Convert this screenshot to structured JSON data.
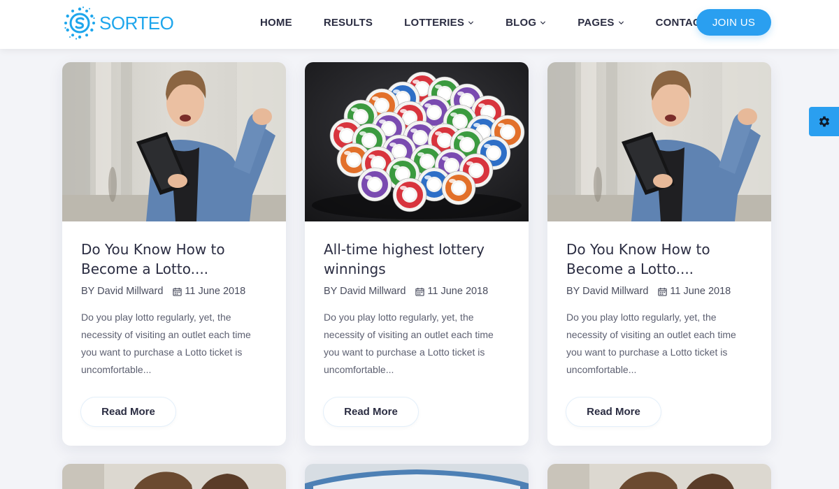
{
  "brand": {
    "name": "SORTEO",
    "accent": "#2a9ff0"
  },
  "nav": {
    "items": [
      {
        "label": "HOME",
        "dropdown": false
      },
      {
        "label": "RESULTS",
        "dropdown": false
      },
      {
        "label": "LOTTERIES",
        "dropdown": true
      },
      {
        "label": "BLOG",
        "dropdown": true
      },
      {
        "label": "PAGES",
        "dropdown": true
      },
      {
        "label": "CONTACT US",
        "dropdown": false
      }
    ],
    "cta_label": "JOIN US"
  },
  "settings_icon": "gear-icon",
  "posts": [
    {
      "image": "man-celebrating-with-tablet",
      "title_line1": "Do You Know How to",
      "title_line2": "Become a Lotto....",
      "author": "BY David Millward",
      "date": "11 June 2018",
      "excerpt": "Do you play lotto regularly, yet, the necessity of visiting an outlet each time you want to purchase a Lotto ticket is uncomfortable...",
      "button": "Read More"
    },
    {
      "image": "lottery-balls",
      "title_line1": "All-time highest lottery",
      "title_line2": "winnings",
      "author": "BY David Millward",
      "date": "11 June 2018",
      "excerpt": "Do you play lotto regularly, yet, the necessity of visiting an outlet each time you want to purchase a Lotto ticket is uncomfortable...",
      "button": "Read More"
    },
    {
      "image": "man-celebrating-with-tablet",
      "title_line1": "Do You Know How to",
      "title_line2": "Become a Lotto....",
      "author": "BY David Millward",
      "date": "11 June 2018",
      "excerpt": "Do you play lotto regularly, yet, the necessity of visiting an outlet each time you want to purchase a Lotto ticket is uncomfortable...",
      "button": "Read More"
    }
  ]
}
